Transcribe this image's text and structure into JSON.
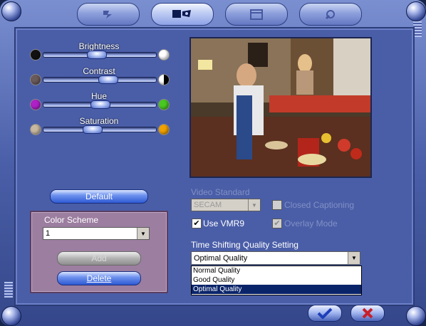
{
  "tabs": [
    {
      "icon": "channel-icon"
    },
    {
      "icon": "tv-settings-icon"
    },
    {
      "icon": "schedule-icon"
    },
    {
      "icon": "tools-icon"
    }
  ],
  "sliders": {
    "brightness": {
      "label": "Brightness",
      "value": 0.46
    },
    "contrast": {
      "label": "Contrast",
      "value": 0.58
    },
    "hue": {
      "label": "Hue",
      "value": 0.5
    },
    "saturation": {
      "label": "Saturation",
      "value": 0.42
    }
  },
  "default_label": "Default",
  "color_scheme": {
    "title": "Color Scheme",
    "selected": "1",
    "add_label": "Add",
    "delete_label": "Delete"
  },
  "video_standard": {
    "label": "Video Standard",
    "value": "SECAM"
  },
  "closed_captioning_label": "Closed Captioning",
  "use_vmr9_label": "Use VMR9",
  "overlay_mode_label": "Overlay Mode",
  "time_shifting": {
    "label": "Time Shifting Quality Setting",
    "selected": "Optimal Quality",
    "options": [
      "Normal Quality",
      "Good Quality",
      "Optimal Quality"
    ]
  },
  "colors": {
    "panel": "#4a5ea8",
    "accent": "#2e5ad4",
    "scheme_box": "#9c7ea0"
  }
}
